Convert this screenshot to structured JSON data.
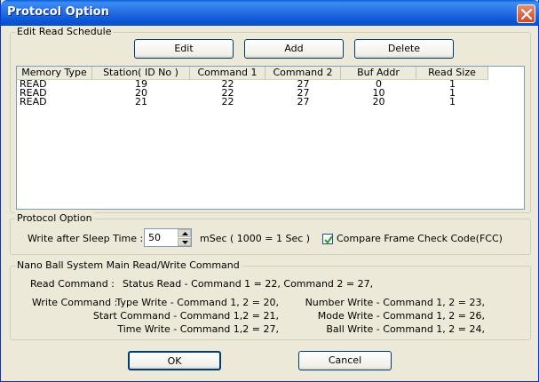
{
  "window": {
    "title": "Protocol Option"
  },
  "schedule_group": {
    "label": "Edit Read Schedule",
    "buttons": {
      "edit": "Edit",
      "add": "Add",
      "delete": "Delete"
    },
    "columns": [
      "Memory Type",
      "Station( ID No )",
      "Command 1",
      "Command 2",
      "Buf Addr",
      "Read Size"
    ],
    "rows": [
      [
        "READ",
        "19",
        "22",
        "27",
        "0",
        "1"
      ],
      [
        "READ",
        "20",
        "22",
        "27",
        "10",
        "1"
      ],
      [
        "READ",
        "21",
        "22",
        "27",
        "20",
        "1"
      ]
    ]
  },
  "protocol_group": {
    "label": "Protocol Option",
    "sleep_label": "Write after Sleep Time :",
    "sleep_value": "50",
    "sleep_unit": "mSec ( 1000 = 1 Sec )",
    "fcc_label": "Compare Frame Check Code(FCC)",
    "fcc_checked": true
  },
  "nano_group": {
    "label": "Nano Ball System Main Read/Write Command",
    "read_label": "Read Command :",
    "read_text": "Status Read - Command 1 = 22, Command 2 = 27,",
    "write_label": "Write Command :",
    "write_left": [
      "Type Write - Command 1, 2 = 20,",
      "Start Command - Command 1,2 = 21,",
      "Time Write - Command 1,2 = 27,"
    ],
    "write_right": [
      "Number Write - Command 1, 2 = 23,",
      "Mode Write - Command 1, 2 = 26,",
      "Ball Write - Command 1, 2 = 24,"
    ]
  },
  "footer": {
    "ok": "OK",
    "cancel": "Cancel"
  }
}
